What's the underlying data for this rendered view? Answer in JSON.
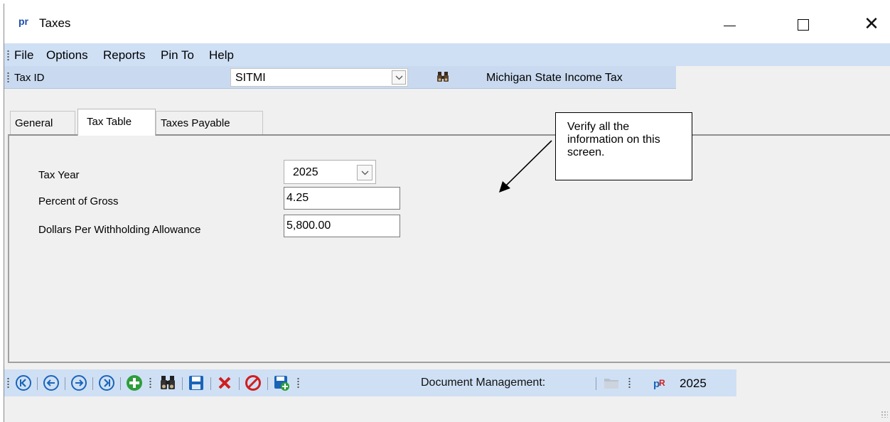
{
  "window": {
    "app_icon": "pr",
    "title": "Taxes"
  },
  "menu": {
    "items": [
      "File",
      "Options",
      "Reports",
      "Pin To",
      "Help"
    ]
  },
  "toolbar": {
    "tax_id_label": "Tax ID",
    "tax_id_value": "SITMI",
    "search_icon": "binoculars-icon",
    "tax_description": "Michigan State Income Tax"
  },
  "tabs": [
    {
      "label": "General",
      "active": false
    },
    {
      "label": "Tax Table",
      "active": true
    },
    {
      "label": "Taxes Payable",
      "active": false
    }
  ],
  "form": {
    "tax_year_label": "Tax Year",
    "tax_year_value": "2025",
    "percent_gross_label": "Percent of Gross",
    "percent_gross_value": "4.25",
    "dollars_allowance_label": "Dollars Per Withholding Allowance",
    "dollars_allowance_value": "5,800.00"
  },
  "callout": {
    "text": "Verify all the information on this screen."
  },
  "nav_toolbar": {
    "icons": [
      "first-record-icon",
      "previous-record-icon",
      "next-record-icon",
      "last-record-icon",
      "add-icon",
      "search-icon",
      "save-icon",
      "delete-icon",
      "cancel-icon",
      "save-new-icon",
      "folder-icon",
      "report-icon"
    ],
    "document_management_label": "Document Management:",
    "year_label": "2025"
  },
  "colors": {
    "toolbar_bg": "#cfe0f5",
    "nav_icon_blue": "#1a64b8",
    "add_green": "#2e9d3a",
    "delete_red": "#d01e1e",
    "app_icon_blue": "#1f4fa8"
  }
}
